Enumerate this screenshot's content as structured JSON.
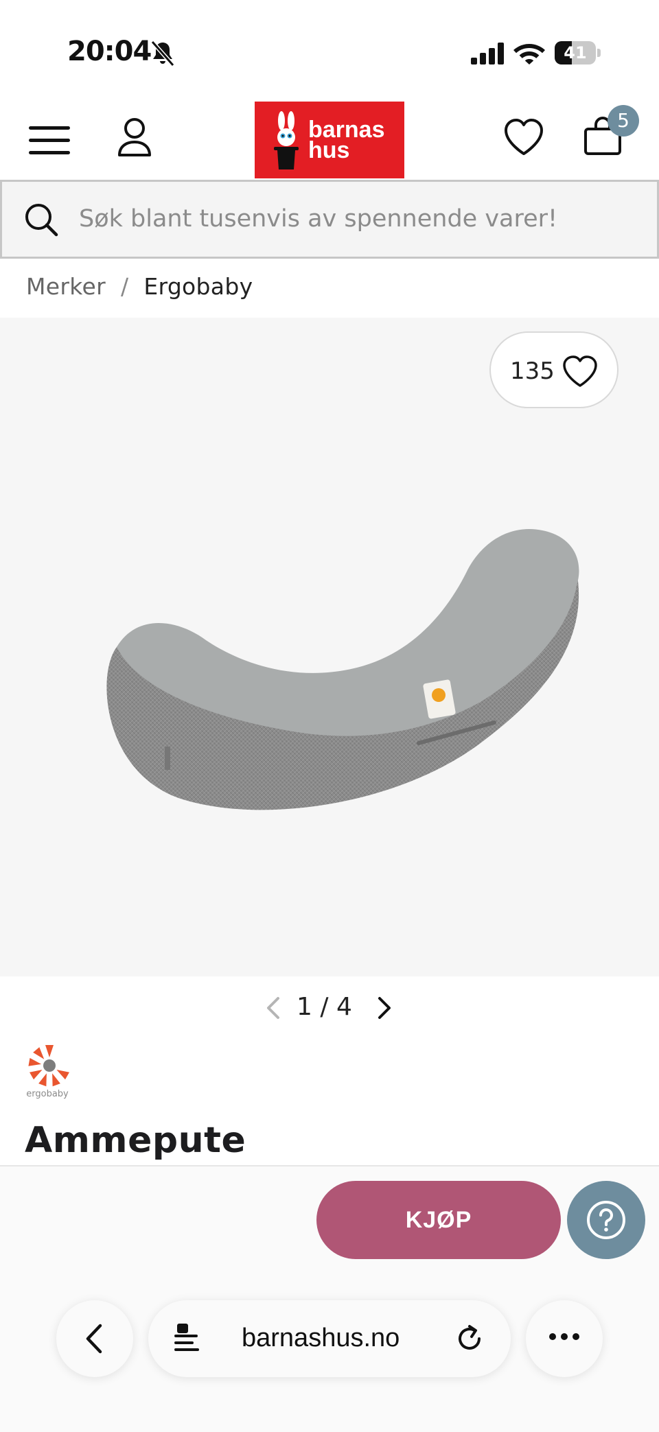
{
  "status_bar": {
    "time": "20:04",
    "battery_level": "41",
    "battery_fraction": 0.41
  },
  "header": {
    "logo_line1": "barnas",
    "logo_line2": "hus",
    "cart_count": "5",
    "brand_color": "#e31e24",
    "badge_color": "#6e8d9e"
  },
  "search": {
    "placeholder": "Søk blant tusenvis av spennende varer!"
  },
  "breadcrumb": {
    "items": [
      "Merker",
      "Ergobaby"
    ],
    "separator": "/"
  },
  "gallery": {
    "favorite_count": "135",
    "current": "1",
    "total": "4",
    "separator": "/"
  },
  "product": {
    "brand_logo_text": "ergobaby",
    "title": "Ammepute"
  },
  "actions": {
    "buy_label": "KJØP",
    "buy_color": "#b05675",
    "help_color": "#6e8d9e"
  },
  "browser": {
    "url": "barnashus.no"
  },
  "icons": [
    "bell-slash-icon",
    "signal-icon",
    "wifi-icon",
    "menu-icon",
    "account-icon",
    "heart-icon",
    "cart-icon",
    "search-icon",
    "chevron-left-icon",
    "chevron-right-icon",
    "help-icon",
    "back-icon",
    "page-icon",
    "reload-icon",
    "more-icon"
  ]
}
